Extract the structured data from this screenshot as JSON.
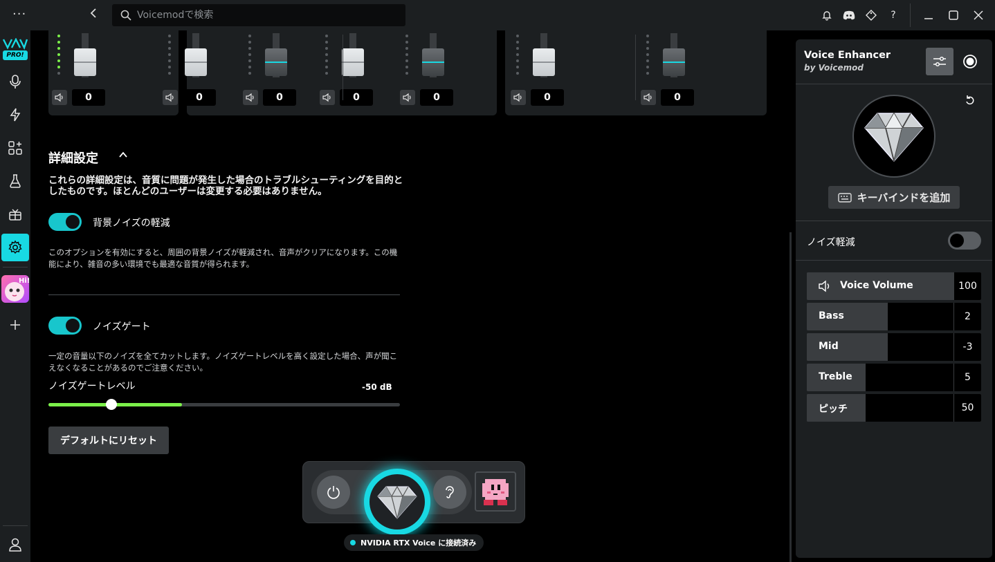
{
  "titlebar": {
    "search_placeholder": "Voicemodで検索"
  },
  "rail": {
    "logo_badge": "PRO!"
  },
  "mixer": {
    "channels": [
      {
        "value": "0"
      },
      {
        "value": "0"
      },
      {
        "value": "0"
      },
      {
        "value": "0"
      },
      {
        "value": "0"
      },
      {
        "value": "0"
      },
      {
        "value": "0"
      }
    ]
  },
  "advanced": {
    "title": "詳細設定",
    "description": "これらの詳細設定は、音質に問題が発生した場合のトラブルシューティングを目的としたものです。ほとんどのユーザーは変更する必要はありません。",
    "noise_reduction": {
      "label": "背景ノイズの軽減",
      "enabled": true,
      "description": "このオプションを有効にすると、周囲の背景ノイズが軽減され、音声がクリアになります。この機能により、雑音の多い環境でも最適な音質が得られます。"
    },
    "noise_gate": {
      "label": "ノイズゲート",
      "enabled": true,
      "description": "一定の音量以下のノイズを全てカットします。ノイズゲートレベルを高く設定した場合、声が聞こえなくなることがあるのでご注意ください。",
      "level_label": "ノイズゲートレベル",
      "level_value": "-50 dB",
      "slider_fraction": 0.18,
      "fill_fraction": 0.38
    },
    "reset_label": "デフォルトにリセット"
  },
  "dock": {
    "status": "NVIDIA RTX Voice に接続済み"
  },
  "panel": {
    "title": "Voice Enhancer",
    "subtitle": "by Voicemod",
    "keybind_label": "キーバインドを追加",
    "noise_reduction_label": "ノイズ軽減",
    "noise_reduction_enabled": false,
    "params": [
      {
        "label": "Voice Volume",
        "value": "100",
        "fraction": 1.0
      },
      {
        "label": "Bass",
        "value": "2",
        "fraction": 0.55
      },
      {
        "label": "Mid",
        "value": "-3",
        "fraction": 0.55
      },
      {
        "label": "Treble",
        "value": "5",
        "fraction": 0.4
      },
      {
        "label": "ピッチ",
        "value": "50",
        "fraction": 0.4
      }
    ]
  },
  "colors": {
    "accent": "#18d9e3",
    "meter_green": "#7cf04a",
    "background": "#000000",
    "surface": "#1c1f21"
  }
}
